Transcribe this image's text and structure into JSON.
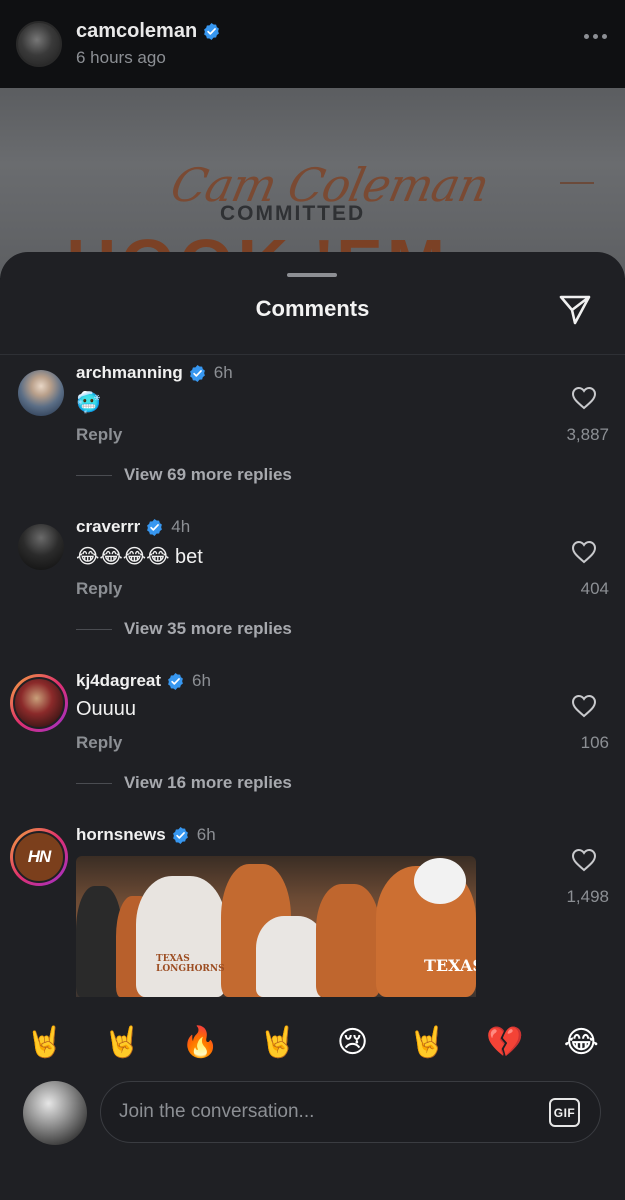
{
  "post": {
    "username": "camcoleman",
    "time": "6 hours ago",
    "image_script": "Cam Coleman",
    "image_committed": "COMMITTED",
    "image_big": "HOOK 'EM"
  },
  "sheet": {
    "title": "Comments"
  },
  "comments": [
    {
      "username": "archmanning",
      "time": "6h",
      "text": "🥶",
      "reply": "Reply",
      "likes": "3,887",
      "more_replies": "View 69 more replies"
    },
    {
      "username": "craverrr",
      "time": "4h",
      "text": "😂😂😂😂 bet",
      "reply": "Reply",
      "likes": "404",
      "more_replies": "View 35 more replies"
    },
    {
      "username": "kj4dagreat",
      "time": "6h",
      "text": "Ouuuu",
      "reply": "Reply",
      "likes": "106",
      "more_replies": "View 16 more replies"
    },
    {
      "username": "hornsnews",
      "time": "6h",
      "avatar_text": "HN",
      "likes": "1,498",
      "gif_text": "TEXAS LONGHORNS",
      "gif_text2": "TEXAS"
    }
  ],
  "emoji_bar": [
    "🤘",
    "🤘",
    "🔥",
    "🤘",
    "😢",
    "🤘",
    "💔",
    "😂"
  ],
  "input": {
    "placeholder": "Join the conversation...",
    "gif_label": "GIF"
  },
  "colors": {
    "sheet_bg": "#1f2024",
    "verified_blue": "#3797f0",
    "muted_text": "#8c8f94"
  }
}
